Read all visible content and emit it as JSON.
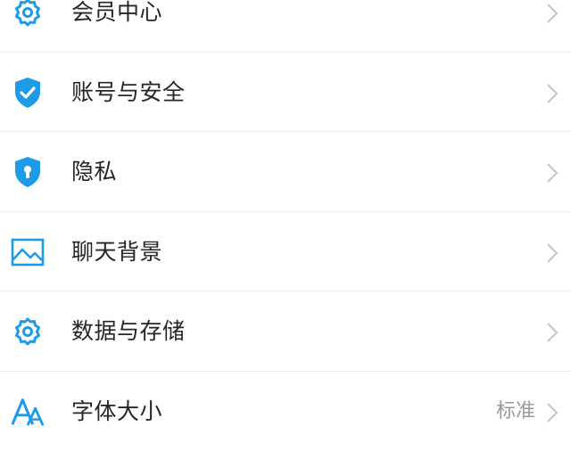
{
  "colors": {
    "accent": "#1e9be6",
    "text": "#262626",
    "secondary_text": "#9a9a9a",
    "divider": "#ececec",
    "chevron": "#c4c4c4"
  },
  "settings": {
    "items": [
      {
        "label": "会员中心",
        "icon": "gear-icon"
      },
      {
        "label": "账号与安全",
        "icon": "shield-check-icon"
      },
      {
        "label": "隐私",
        "icon": "shield-keyhole-icon"
      },
      {
        "label": "聊天背景",
        "icon": "image-icon"
      },
      {
        "label": "数据与存储",
        "icon": "gear-icon"
      },
      {
        "label": "字体大小",
        "icon": "font-size-icon",
        "value": "标准"
      }
    ]
  }
}
